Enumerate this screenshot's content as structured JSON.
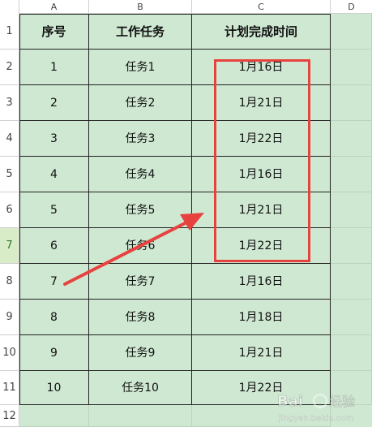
{
  "columns": [
    "A",
    "B",
    "C",
    "D"
  ],
  "row_numbers": [
    "1",
    "2",
    "3",
    "4",
    "5",
    "6",
    "7",
    "8",
    "9",
    "10",
    "11",
    "12"
  ],
  "active_row": "7",
  "headers": {
    "index": "序号",
    "task": "工作任务",
    "plan_time": "计划完成时间"
  },
  "rows": [
    {
      "index": "1",
      "task": "任务1",
      "plan_time": "1月16日"
    },
    {
      "index": "2",
      "task": "任务2",
      "plan_time": "1月21日"
    },
    {
      "index": "3",
      "task": "任务3",
      "plan_time": "1月22日"
    },
    {
      "index": "4",
      "task": "任务4",
      "plan_time": "1月16日"
    },
    {
      "index": "5",
      "task": "任务5",
      "plan_time": "1月21日"
    },
    {
      "index": "6",
      "task": "任务6",
      "plan_time": "1月22日"
    },
    {
      "index": "7",
      "task": "任务7",
      "plan_time": "1月16日"
    },
    {
      "index": "8",
      "task": "任务8",
      "plan_time": "1月18日"
    },
    {
      "index": "9",
      "task": "任务9",
      "plan_time": "1月21日"
    },
    {
      "index": "10",
      "task": "任务10",
      "plan_time": "1月22日"
    }
  ],
  "colors": {
    "cell_fill": "#cfe8d2",
    "annotation_red": "#e8423f"
  },
  "watermark": {
    "brand": "Bai",
    "brand_suffix": "经验",
    "url": "jingyan.baidu.com"
  }
}
